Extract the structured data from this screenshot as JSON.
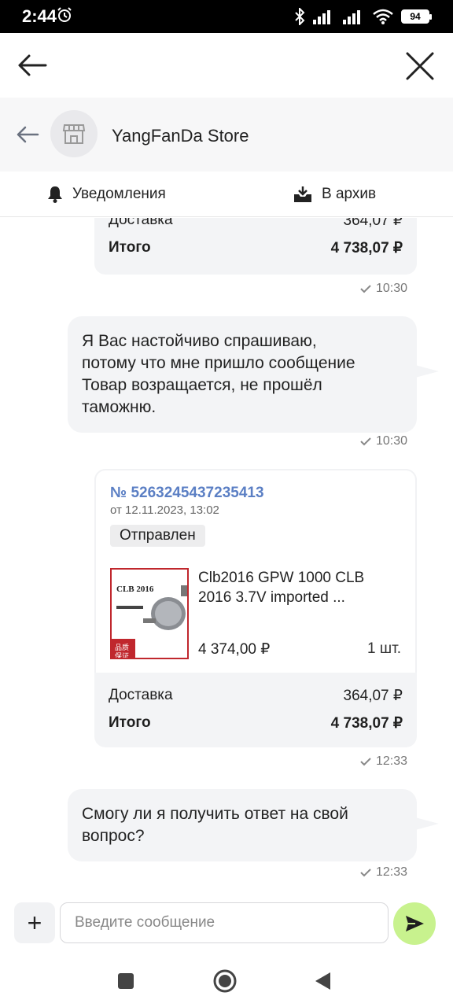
{
  "status_bar": {
    "time": "2:44",
    "battery": "94"
  },
  "store": {
    "name": "YangFanDa Store"
  },
  "actions": {
    "notifications": "Уведомления",
    "archive": "В архив"
  },
  "partial_card": {
    "delivery_label": "Доставка",
    "delivery_value": "364,07 ₽",
    "total_label": "Итого",
    "total_value": "4 738,07 ₽",
    "time": "10:30"
  },
  "message1": {
    "lines": [
      "Я Вас настойчиво спрашиваю,",
      "потому что мне пришло сообщение",
      "Товар возращается, не прошёл",
      "таможню."
    ],
    "time": "10:30"
  },
  "order_card": {
    "number": "№ 5263245437235413",
    "date": "от 12.11.2023, 13:02",
    "status": "Отправлен",
    "product_name": "Clb2016 GPW 1000 CLB 2016 3.7V imported ...",
    "product_img_text": "CLB 2016",
    "product_img_stamp": "品质保证",
    "price": "4 374,00 ₽",
    "quantity": "1 шт.",
    "delivery_label": "Доставка",
    "delivery_value": "364,07 ₽",
    "total_label": "Итого",
    "total_value": "4 738,07 ₽",
    "time": "12:33"
  },
  "message2": {
    "lines": [
      "Смогу ли я получить ответ на свой",
      "вопрос?"
    ],
    "time": "12:33"
  },
  "input": {
    "placeholder": "Введите сообщение",
    "plus": "+"
  },
  "colors": {
    "accent_green": "#c8f28e",
    "order_link": "#5b7fc4",
    "bubble": "#f3f4f6"
  }
}
